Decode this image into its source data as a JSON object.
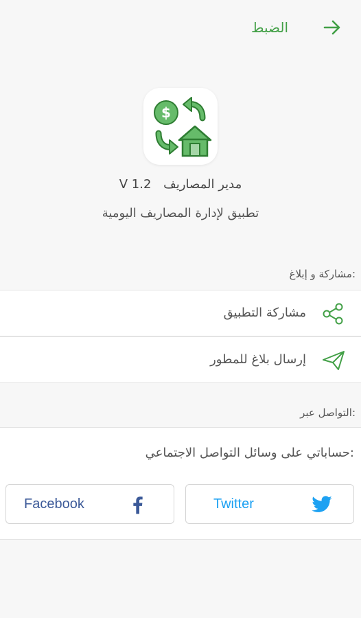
{
  "header": {
    "title": "الضبط",
    "back_icon": "arrow-right-icon"
  },
  "app": {
    "name": "مدير المصاريف",
    "version": "V 1.2",
    "description": "تطبيق لإدارة المصاريف اليومية",
    "logo_icon": "money-house-exchange-icon"
  },
  "share_section": {
    "title": "مشاركة و إبلاغ:",
    "items": [
      {
        "label": "مشاركة التطبيق",
        "icon": "share-icon"
      },
      {
        "label": "إرسال بلاغ للمطور",
        "icon": "send-icon"
      }
    ]
  },
  "contact_section": {
    "title": "التواصل عبر:",
    "social_text": "حساباتي على وسائل التواصل الاجتماعي:",
    "buttons": [
      {
        "label": "Twitter",
        "icon": "twitter-icon",
        "color": "#1da1f2"
      },
      {
        "label": "Facebook",
        "icon": "facebook-icon",
        "color": "#3b5998"
      }
    ]
  },
  "colors": {
    "accent": "#43a047",
    "background": "#f7f7f7"
  }
}
